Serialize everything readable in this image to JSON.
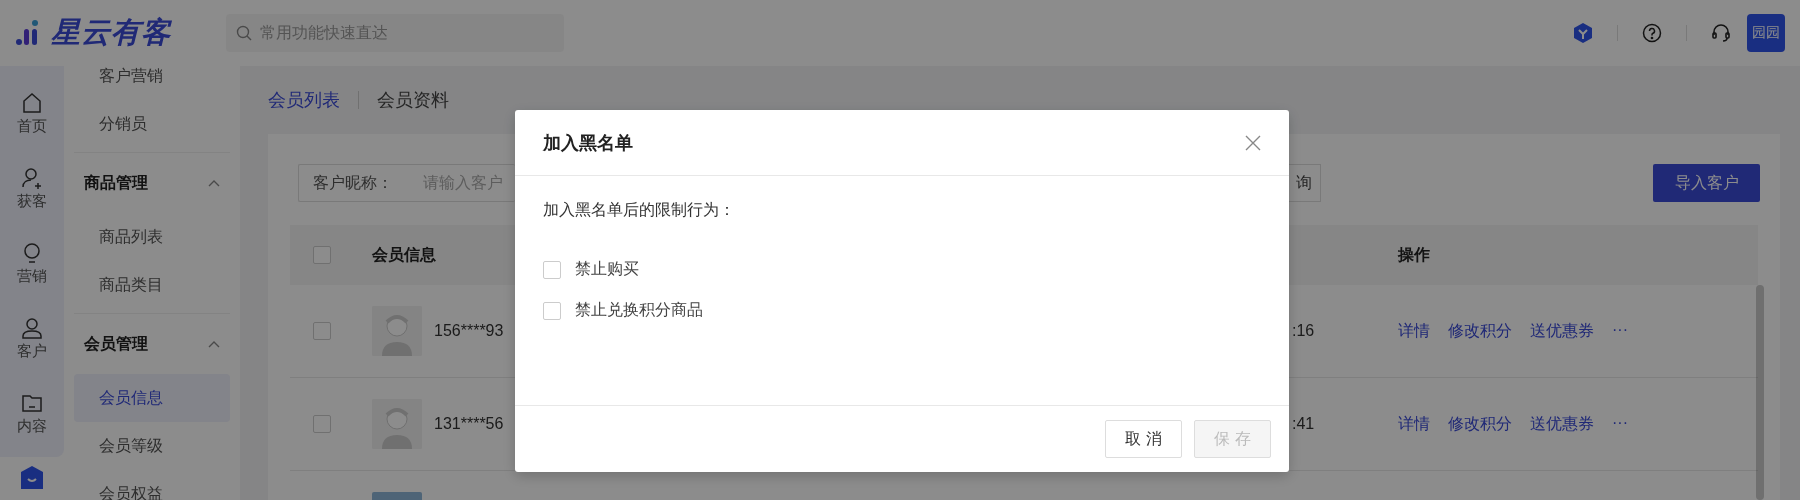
{
  "header": {
    "logo": "星云有客",
    "search": {
      "placeholder": "常用功能快速直达"
    },
    "avatar": "园园"
  },
  "rail": [
    {
      "label": "首页",
      "selected": false
    },
    {
      "label": "获客",
      "selected": false
    },
    {
      "label": "营销",
      "selected": false
    },
    {
      "label": "客户",
      "selected": false
    },
    {
      "label": "内容",
      "selected": false
    },
    {
      "selected": true
    }
  ],
  "subnav": [
    {
      "kind": "item",
      "label": "客户营销",
      "selected": false
    },
    {
      "kind": "item",
      "label": "分销员",
      "selected": false
    },
    {
      "kind": "group",
      "label": "商品管理",
      "expanded": true
    },
    {
      "kind": "item",
      "label": "商品列表",
      "selected": false
    },
    {
      "kind": "item",
      "label": "商品类目",
      "selected": false
    },
    {
      "kind": "group",
      "label": "会员管理",
      "expanded": true
    },
    {
      "kind": "item",
      "label": "会员信息",
      "selected": true
    },
    {
      "kind": "item",
      "label": "会员等级",
      "selected": false
    },
    {
      "kind": "item",
      "label": "会员权益",
      "selected": false
    }
  ],
  "tabs": [
    {
      "label": "会员列表",
      "selected": true
    },
    {
      "label": "会员资料",
      "selected": false
    }
  ],
  "filter": {
    "label": "客户昵称：",
    "placeholder": "请输入客户",
    "button": "询"
  },
  "import_button": "导入客户",
  "table": {
    "columns": [
      "会员信息",
      "操作"
    ],
    "all_checked": false,
    "rows": [
      {
        "kind": "member",
        "checked": false,
        "member": "156****93",
        "time": ":16",
        "actions": [
          "详情",
          "修改积分",
          "送优惠券",
          "···"
        ]
      },
      {
        "kind": "member",
        "checked": false,
        "member": "131****56",
        "time": ":41",
        "actions": [
          "详情",
          "修改积分",
          "送优惠券",
          "···"
        ]
      },
      {
        "kind": "picture"
      }
    ]
  },
  "dialog": {
    "title": "加入黑名单",
    "prompt": "加入黑名单后的限制行为：",
    "options": [
      {
        "label": "禁止购买",
        "checked": false
      },
      {
        "label": "禁止兑换积分商品",
        "checked": false
      }
    ],
    "buttons": [
      {
        "label": "取 消",
        "disabled": false
      },
      {
        "label": "保 存",
        "disabled": true
      }
    ]
  }
}
